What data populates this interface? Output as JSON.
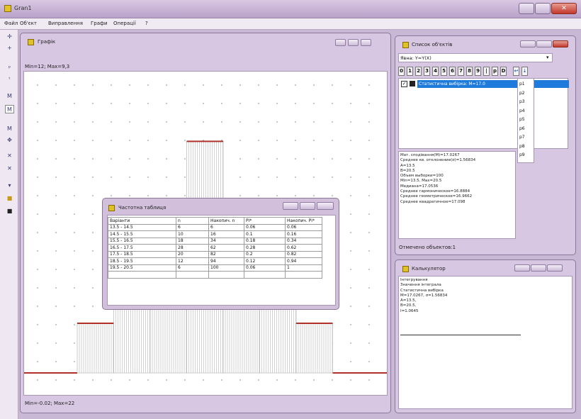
{
  "window": {
    "title": "Gran1"
  },
  "menu": [
    "Файл",
    "Об'єкт",
    "Виправлення",
    "Графи",
    "Операції",
    "?"
  ],
  "toolbar_icons": [
    "plus-icon",
    "plus-icon",
    "p-icon",
    "t-icon",
    "mg-icon",
    "mx-icon",
    "mplus-icon",
    "move-icon",
    "x-icon",
    "x2-icon",
    "pin-icon",
    "folder-icon",
    "save-icon"
  ],
  "graph_window": {
    "title": "Графік",
    "header_status": "Min=12; Max=9,3",
    "footer_status": "Min=-0.02; Max=22"
  },
  "freq_table": {
    "title": "Частотна таблиця",
    "headers": [
      "Варіанти",
      "n",
      "Накопич. n",
      "Рі*",
      "Накопич. Рі*"
    ],
    "rows": [
      [
        "13.5 - 14.5",
        "6",
        "6",
        "0.06",
        "0.06"
      ],
      [
        "14.5 - 15.5",
        "10",
        "16",
        "0.1",
        "0.16"
      ],
      [
        "15.5 - 16.5",
        "18",
        "34",
        "0.18",
        "0.34"
      ],
      [
        "16.5 - 17.5",
        "28",
        "62",
        "0.28",
        "0.62"
      ],
      [
        "17.5 - 18.5",
        "20",
        "82",
        "0.2",
        "0.82"
      ],
      [
        "18.5 - 19.5",
        "12",
        "94",
        "0.12",
        "0.94"
      ],
      [
        "19.5 - 20.5",
        "6",
        "100",
        "0.06",
        "1"
      ],
      [
        "",
        "",
        "",
        "",
        ""
      ]
    ]
  },
  "objects_window": {
    "title": "Список об'єктів",
    "layer_select": "Явна: Y=Y(X)",
    "tab_buttons": [
      "0",
      "1",
      "2",
      "3",
      "4",
      "5",
      "6",
      "7",
      "8",
      "9",
      "|",
      "p",
      "D"
    ],
    "object_item": "Статистична вибірка: M=17.0",
    "p_items": [
      "p1",
      "p2",
      "p3",
      "p4",
      "p5",
      "p6",
      "p7",
      "p8",
      "p9"
    ],
    "info_lines": [
      "Мат. сподівання(M)=17.0267",
      "Среднее кв. отклонение(σ)=1.56834",
      "A=13.5",
      "B=20.5",
      "Объем выборки=100",
      "Min=13.5, Max=20.5",
      "Медиана=17.0536",
      "Среднее гармоническое=16.8884",
      "Среднее геометрическое=16.9662",
      "Среднее квадратичное=17.098"
    ],
    "status": "Отмечено объектов:1"
  },
  "calculator_window": {
    "title": "Калькулятор",
    "lines": [
      "Інтегрування",
      "Значення інтеграла",
      "Статистична вибірка",
      "M=17.0267, σ=1.56834",
      "A=13.5,",
      "B=20.5,",
      "I=1.0645"
    ]
  },
  "chart_data": {
    "type": "bar",
    "categories": [
      "13.5 - 14.5",
      "14.5 - 15.5",
      "15.5 - 16.5",
      "16.5 - 17.5",
      "17.5 - 18.5",
      "18.5 - 19.5",
      "19.5 - 20.5"
    ],
    "values": [
      0.06,
      0.1,
      0.18,
      0.28,
      0.2,
      0.12,
      0.06
    ],
    "ylim": [
      0,
      0.3
    ]
  },
  "colors": {
    "bar_top": "#b0302a",
    "bar_fill": "#bfbfbf",
    "selection": "#1e7bdc"
  }
}
